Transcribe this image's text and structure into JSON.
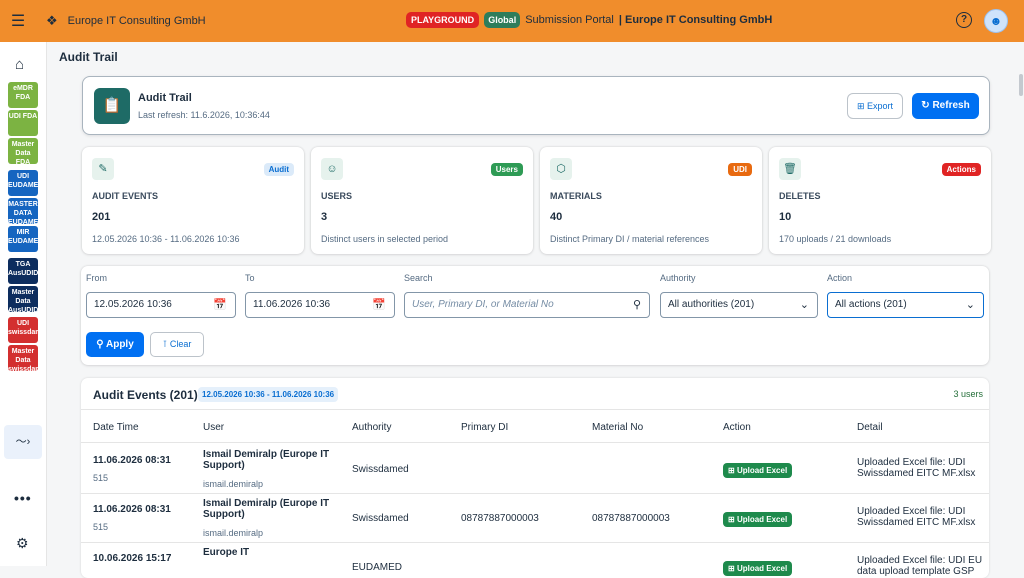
{
  "shell": {
    "company": "Europe IT Consulting GmbH",
    "env_badge": "PLAYGROUND",
    "scope_badge": "Global",
    "portal": "Submission Portal",
    "portal_company": "| Europe IT Consulting GmbH",
    "help_icon": "?",
    "avatar_icon": "person-icon"
  },
  "sidebar": {
    "items": [
      {
        "label": "eMDR FDA",
        "color": "#7cb342"
      },
      {
        "label": "UDI FDA",
        "color": "#7cb342"
      },
      {
        "label": "Master Data FDA",
        "color": "#7cb342"
      },
      {
        "label": "UDI EUDAMED",
        "color": "#1565c0"
      },
      {
        "label": "MASTER DATA EUDAMED",
        "color": "#1565c0"
      },
      {
        "label": "MIR EUDAMED",
        "color": "#1565c0"
      },
      {
        "label": "TGA AusUDID",
        "color": "#0d2d5e"
      },
      {
        "label": "Master Data AusUDID",
        "color": "#0d2d5e"
      },
      {
        "label": "UDI swissdamed",
        "color": "#d32f2f"
      },
      {
        "label": "Master Data swissdamed",
        "color": "#d32f2f"
      }
    ],
    "active_icon": "trail-icon"
  },
  "page": {
    "title": "Audit Trail"
  },
  "header": {
    "title": "Audit Trail",
    "subtitle": "Last refresh: 11.6.2026, 10:36:44",
    "export_label": "Export",
    "refresh_label": "Refresh"
  },
  "cards": [
    {
      "tag": "Audit",
      "tag_bg": "#dbeaf9",
      "tag_fg": "#0a6ed1",
      "label": "AUDIT EVENTS",
      "value": "201",
      "sub": "12.05.2026 10:36 - 11.06.2026 10:36"
    },
    {
      "tag": "Users",
      "tag_bg": "#2e9b55",
      "tag_fg": "#ffffff",
      "label": "USERS",
      "value": "3",
      "sub": "Distinct users in selected period"
    },
    {
      "tag": "UDI",
      "tag_bg": "#e86a10",
      "tag_fg": "#ffffff",
      "label": "MATERIALS",
      "value": "40",
      "sub": "Distinct Primary DI / material references"
    },
    {
      "tag": "Actions",
      "tag_bg": "#e02424",
      "tag_fg": "#ffffff",
      "label": "DELETES",
      "value": "10",
      "sub": "170 uploads / 21 downloads"
    }
  ],
  "filters": {
    "from_label": "From",
    "from_value": "12.05.2026 10:36",
    "to_label": "To",
    "to_value": "11.06.2026 10:36",
    "search_label": "Search",
    "search_placeholder": "User, Primary DI, or Material No",
    "authority_label": "Authority",
    "authority_value": "All authorities (201)",
    "action_label": "Action",
    "action_value": "All actions (201)",
    "apply_label": "Apply",
    "clear_label": "Clear"
  },
  "table": {
    "title": "Audit Events (201)",
    "range": "12.05.2026 10:36 - 11.06.2026 10:36",
    "users": "3 users",
    "columns": [
      "Date Time",
      "User",
      "Authority",
      "Primary DI",
      "Material No",
      "Action",
      "Detail"
    ],
    "rows": [
      {
        "date": "11.06.2026 08:31",
        "id": "515",
        "user": "Ismail Demiralp (Europe IT Support)",
        "login": "ismail.demiralp",
        "authority": "Swissdamed",
        "primary_di": "",
        "material": "",
        "action": "Upload Excel",
        "detail": "Uploaded Excel file: UDI Swissdamed EITC MF.xlsx"
      },
      {
        "date": "11.06.2026 08:31",
        "id": "515",
        "user": "Ismail Demiralp (Europe IT Support)",
        "login": "ismail.demiralp",
        "authority": "Swissdamed",
        "primary_di": "08787887000003",
        "material": "08787887000003",
        "action": "Upload Excel",
        "detail": "Uploaded Excel file: UDI Swissdamed EITC MF.xlsx"
      },
      {
        "date": "10.06.2026 15:17",
        "id": "",
        "user": "Europe IT",
        "login": "",
        "authority": "EUDAMED",
        "primary_di": "",
        "material": "",
        "action": "Upload Excel",
        "detail": "Uploaded Excel file: UDI EU data upload template GSP"
      }
    ]
  }
}
